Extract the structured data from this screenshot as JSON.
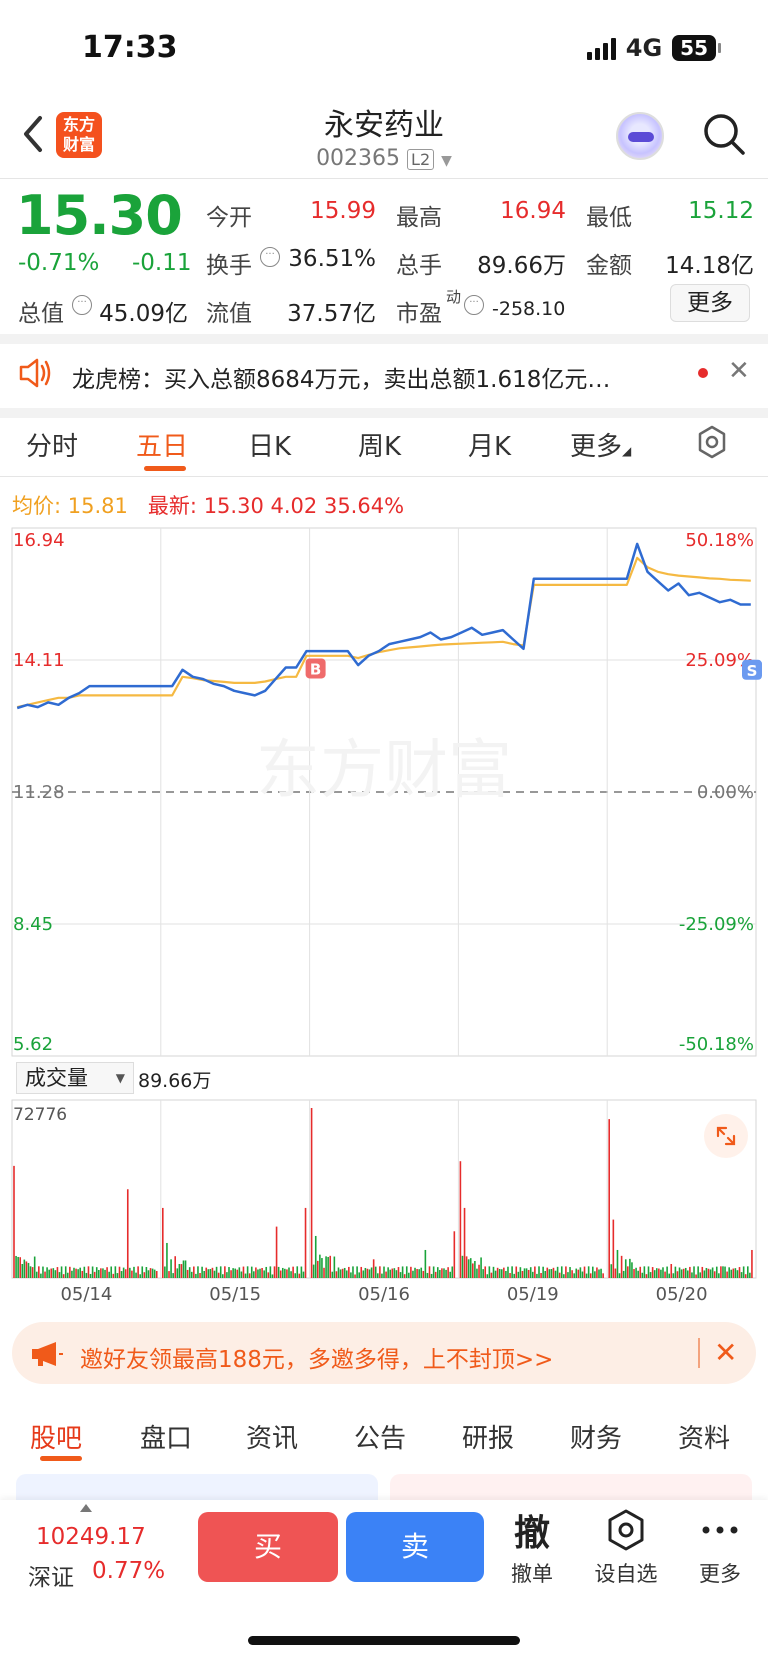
{
  "status": {
    "time": "17:33",
    "network": "4G",
    "battery": "55"
  },
  "header": {
    "logo_line1": "东方",
    "logo_line2": "财富",
    "stock_name": "永安药业",
    "stock_code": "002365",
    "level_badge": "L2"
  },
  "quote": {
    "price": "15.30",
    "change_pct": "-0.71%",
    "change": "-0.11",
    "open_label": "今开",
    "open": "15.99",
    "high_label": "最高",
    "high": "16.94",
    "low_label": "最低",
    "low": "15.12",
    "turnover_label": "换手",
    "turnover": "36.51%",
    "volume_label": "总手",
    "volume": "89.66万",
    "amount_label": "金额",
    "amount": "14.18亿",
    "mktcap_label": "总值",
    "mktcap": "45.09亿",
    "float_label": "流值",
    "float_cap": "37.57亿",
    "pe_label": "市盈",
    "pe_sup": "动",
    "pe": "-258.10",
    "more_label": "更多"
  },
  "news": {
    "text": "龙虎榜：买入总额8684万元，卖出总额1.618亿元…"
  },
  "period_tabs": [
    "分时",
    "五日",
    "日K",
    "周K",
    "月K",
    "更多"
  ],
  "active_period": "五日",
  "indicators": {
    "avg_label": "均价:",
    "avg": "15.81",
    "latest_label": "最新:",
    "latest": "15.30",
    "latest_chg": "4.02",
    "latest_pct": "35.64%"
  },
  "chart_data": {
    "type": "line",
    "title": "",
    "x_dates": [
      "05/14",
      "05/15",
      "05/16",
      "05/19",
      "05/20"
    ],
    "y_left_ticks": [
      "16.94",
      "14.11",
      "11.28",
      "8.45",
      "5.62"
    ],
    "y_right_ticks": [
      "50.18%",
      "25.09%",
      "0.00%",
      "-25.09%",
      "-50.18%"
    ],
    "ylim": [
      5.62,
      16.94
    ],
    "baseline": 11.28,
    "series": [
      {
        "kind": "price",
        "color": "#2f6bd1",
        "values": [
          13.08,
          13.15,
          13.1,
          13.2,
          13.15,
          13.3,
          13.4,
          13.55,
          13.55,
          13.55,
          13.55,
          13.55,
          13.55,
          13.55,
          13.55,
          13.55,
          13.9,
          13.75,
          13.7,
          13.6,
          13.55,
          13.45,
          13.4,
          13.35,
          13.45,
          13.7,
          13.95,
          13.95,
          14.3,
          14.3,
          14.3,
          14.3,
          14.3,
          14.0,
          14.2,
          14.3,
          14.45,
          14.5,
          14.55,
          14.6,
          14.7,
          14.55,
          14.6,
          14.7,
          14.8,
          14.65,
          14.7,
          14.75,
          14.55,
          14.35,
          15.85,
          15.85,
          15.85,
          15.85,
          15.85,
          15.85,
          15.85,
          15.85,
          15.85,
          15.85,
          16.6,
          16.0,
          15.8,
          15.6,
          15.75,
          15.5,
          15.55,
          15.45,
          15.35,
          15.4,
          15.3,
          15.3
        ]
      },
      {
        "kind": "average",
        "color": "#f5b942",
        "values": [
          13.1,
          13.15,
          13.2,
          13.25,
          13.3,
          13.3,
          13.35,
          13.35,
          13.35,
          13.35,
          13.35,
          13.35,
          13.35,
          13.35,
          13.35,
          13.35,
          13.75,
          13.72,
          13.68,
          13.66,
          13.64,
          13.62,
          13.62,
          13.62,
          13.65,
          13.7,
          13.75,
          13.75,
          14.2,
          14.2,
          14.2,
          14.2,
          14.2,
          14.15,
          14.22,
          14.28,
          14.32,
          14.36,
          14.38,
          14.4,
          14.42,
          14.44,
          14.45,
          14.46,
          14.47,
          14.48,
          14.49,
          14.5,
          14.45,
          14.42,
          15.72,
          15.72,
          15.72,
          15.72,
          15.72,
          15.72,
          15.72,
          15.72,
          15.72,
          15.72,
          16.3,
          16.1,
          16.0,
          15.95,
          15.92,
          15.9,
          15.88,
          15.86,
          15.85,
          15.83,
          15.82,
          15.81
        ]
      }
    ],
    "markers": [
      {
        "label": "B",
        "day": "05/16"
      },
      {
        "label": "S",
        "day": "05/20"
      }
    ],
    "volume": {
      "label": "成交量",
      "total": "89.66万",
      "max_tick": "72776",
      "spikes": [
        {
          "day": "05/14",
          "values": [
            48000,
            9000,
            6000,
            5000,
            4000,
            38000,
            3000
          ]
        },
        {
          "day": "05/15",
          "values": [
            30000,
            15000,
            8000,
            6000,
            5000,
            22000,
            30000
          ]
        },
        {
          "day": "05/16",
          "values": [
            72776,
            18000,
            10000,
            9000,
            8000,
            12000,
            20000
          ]
        },
        {
          "day": "05/19",
          "values": [
            50000,
            30000,
            8000,
            4000,
            3000,
            2000,
            2000
          ]
        },
        {
          "day": "05/20",
          "values": [
            68000,
            25000,
            12000,
            8000,
            6000,
            5000,
            12000
          ]
        }
      ]
    }
  },
  "promo": {
    "text": "邀好友领最高188元，多邀多得，上不封顶>>"
  },
  "bottom_tabs": [
    "股吧",
    "盘口",
    "资讯",
    "公告",
    "研报",
    "财务",
    "资料"
  ],
  "active_bottom_tab": "股吧",
  "index": {
    "value": "10249.17",
    "name": "深证",
    "pct": "0.77%"
  },
  "actions": {
    "buy": "买",
    "sell": "卖",
    "cancel_glyph": "撤",
    "cancel": "撤单",
    "watch": "设自选",
    "more": "更多"
  },
  "colors": {
    "up": "#e62c2c",
    "down": "#1aa33a",
    "accent": "#f05a1a",
    "price_line": "#2f6bd1",
    "avg_line": "#f5b942"
  }
}
